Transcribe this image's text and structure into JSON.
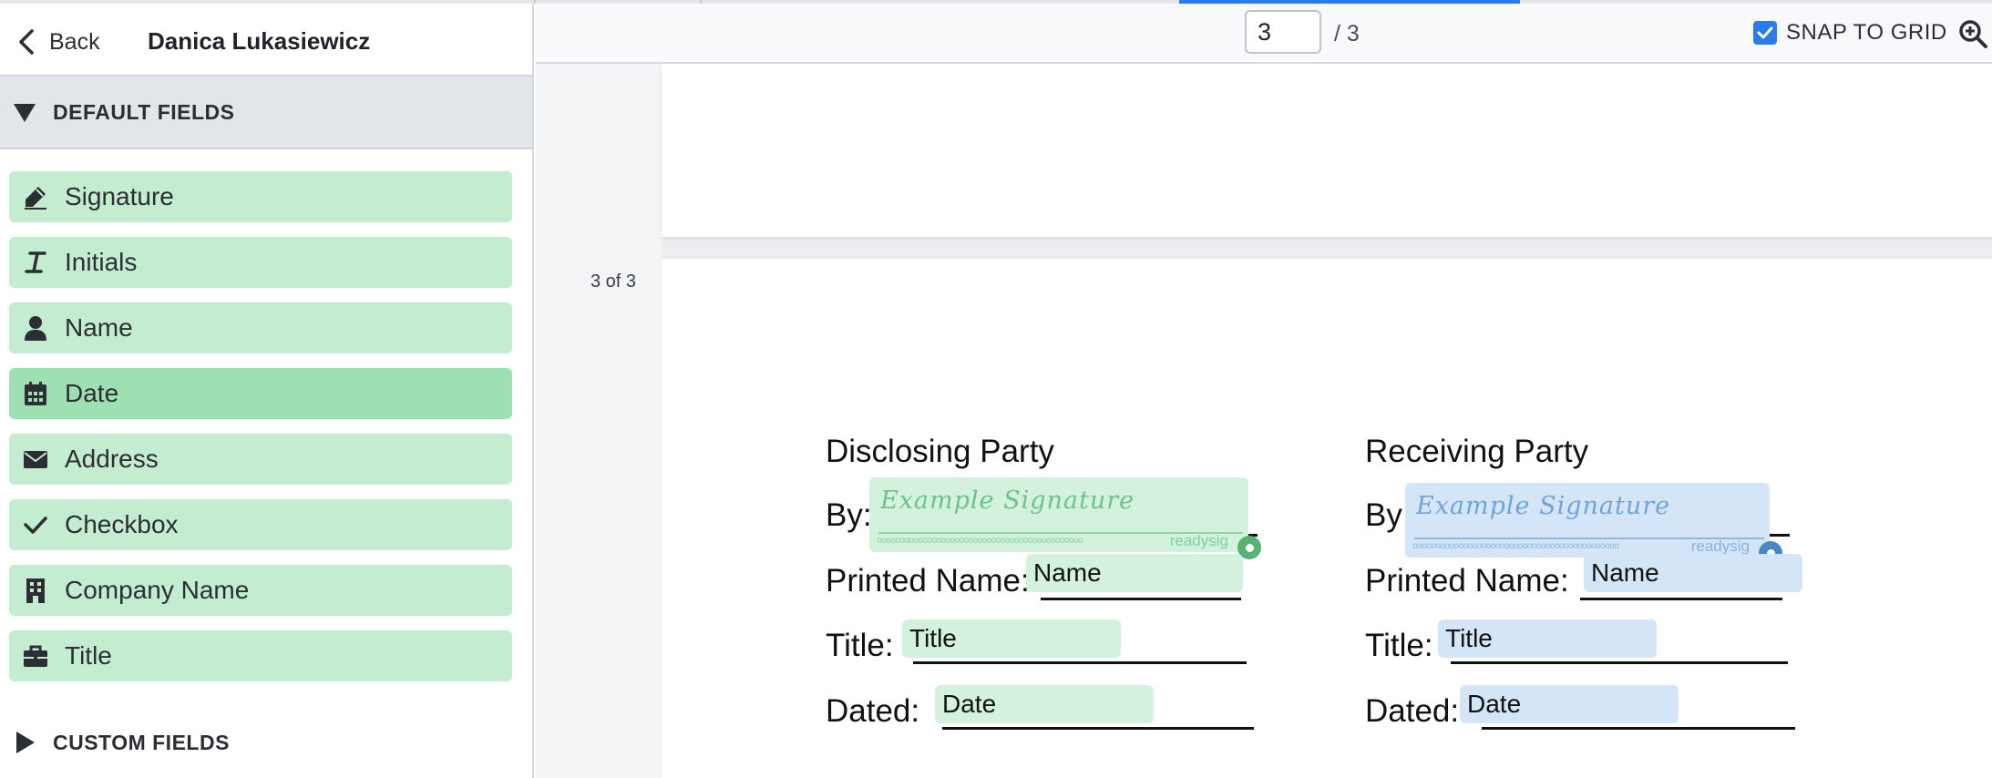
{
  "sidebar": {
    "back_label": "Back",
    "signer_name": "Danica Lukasiewicz",
    "default_section": "DEFAULT FIELDS",
    "custom_section": "CUSTOM FIELDS",
    "fields": [
      {
        "label": "Signature",
        "icon": "pen-icon"
      },
      {
        "label": "Initials",
        "icon": "italic-i-icon"
      },
      {
        "label": "Name",
        "icon": "person-icon"
      },
      {
        "label": "Date",
        "icon": "calendar-icon"
      },
      {
        "label": "Address",
        "icon": "envelope-icon"
      },
      {
        "label": "Checkbox",
        "icon": "check-icon"
      },
      {
        "label": "Company Name",
        "icon": "building-icon"
      },
      {
        "label": "Title",
        "icon": "briefcase-icon"
      }
    ]
  },
  "toolbar": {
    "page_value": "3",
    "page_total": "/ 3",
    "snap_label": "SNAP TO GRID",
    "snap_checked": true
  },
  "document": {
    "page_label": "3 of 3",
    "disclosing": {
      "heading": "Disclosing Party",
      "by": "By:",
      "printed_name": "Printed Name:",
      "title": "Title:",
      "dated": "Dated:",
      "sig_text": "Example Signature",
      "brand": "readysig",
      "name_tag": "Name",
      "title_tag": "Title",
      "date_tag": "Date"
    },
    "receiving": {
      "heading": "Receiving Party",
      "by": "By:",
      "printed_name": "Printed Name:",
      "title": "Title:",
      "dated": "Dated:",
      "sig_text": "Example Signature",
      "brand": "readysig",
      "name_tag": "Name",
      "title_tag": "Title",
      "date_tag": "Date"
    }
  },
  "colors": {
    "accent": "#2b7bea",
    "field_green": "#c4ecd1",
    "field_green_selected": "#9fe0b3",
    "signer1": "#d3f1dc",
    "signer2": "#d3e5f6"
  }
}
